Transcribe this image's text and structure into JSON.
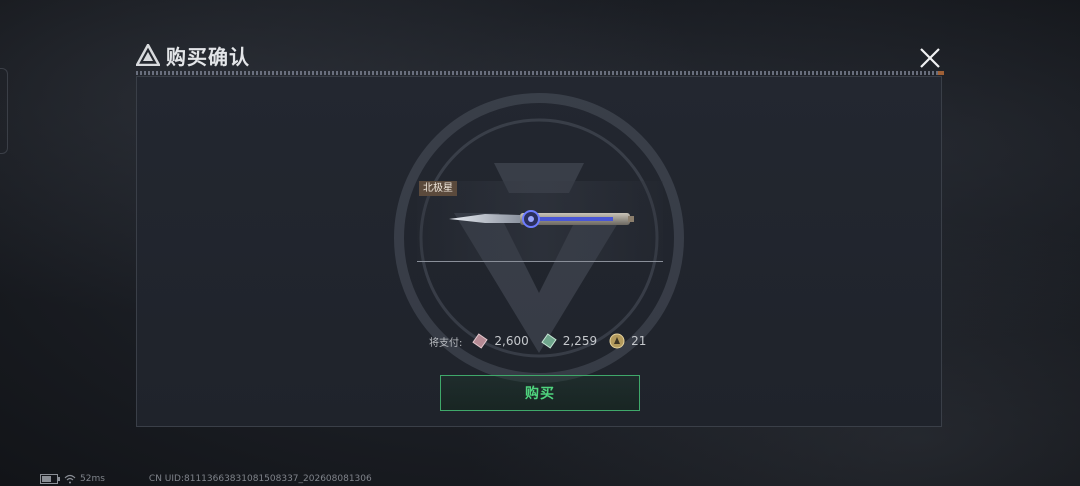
{
  "dialog": {
    "title": "购买确认",
    "close_icon": "close-x-icon"
  },
  "item": {
    "name": "北极星",
    "image_icon": "knife-weapon-image"
  },
  "payment": {
    "label": "将支付:",
    "currencies": [
      {
        "icon": "pink-ticket-icon",
        "value": "2,600"
      },
      {
        "icon": "green-ticket-icon",
        "value": "2,259"
      },
      {
        "icon": "gold-coin-icon",
        "value": "21"
      }
    ]
  },
  "buy_button": {
    "label": "购买",
    "color": "#4fd47e"
  },
  "status": {
    "battery_icon": "battery-icon",
    "wifi_icon": "wifi-icon",
    "ping": "52ms",
    "uid": "CN UID:8111366383108150833​7_202608081306"
  }
}
